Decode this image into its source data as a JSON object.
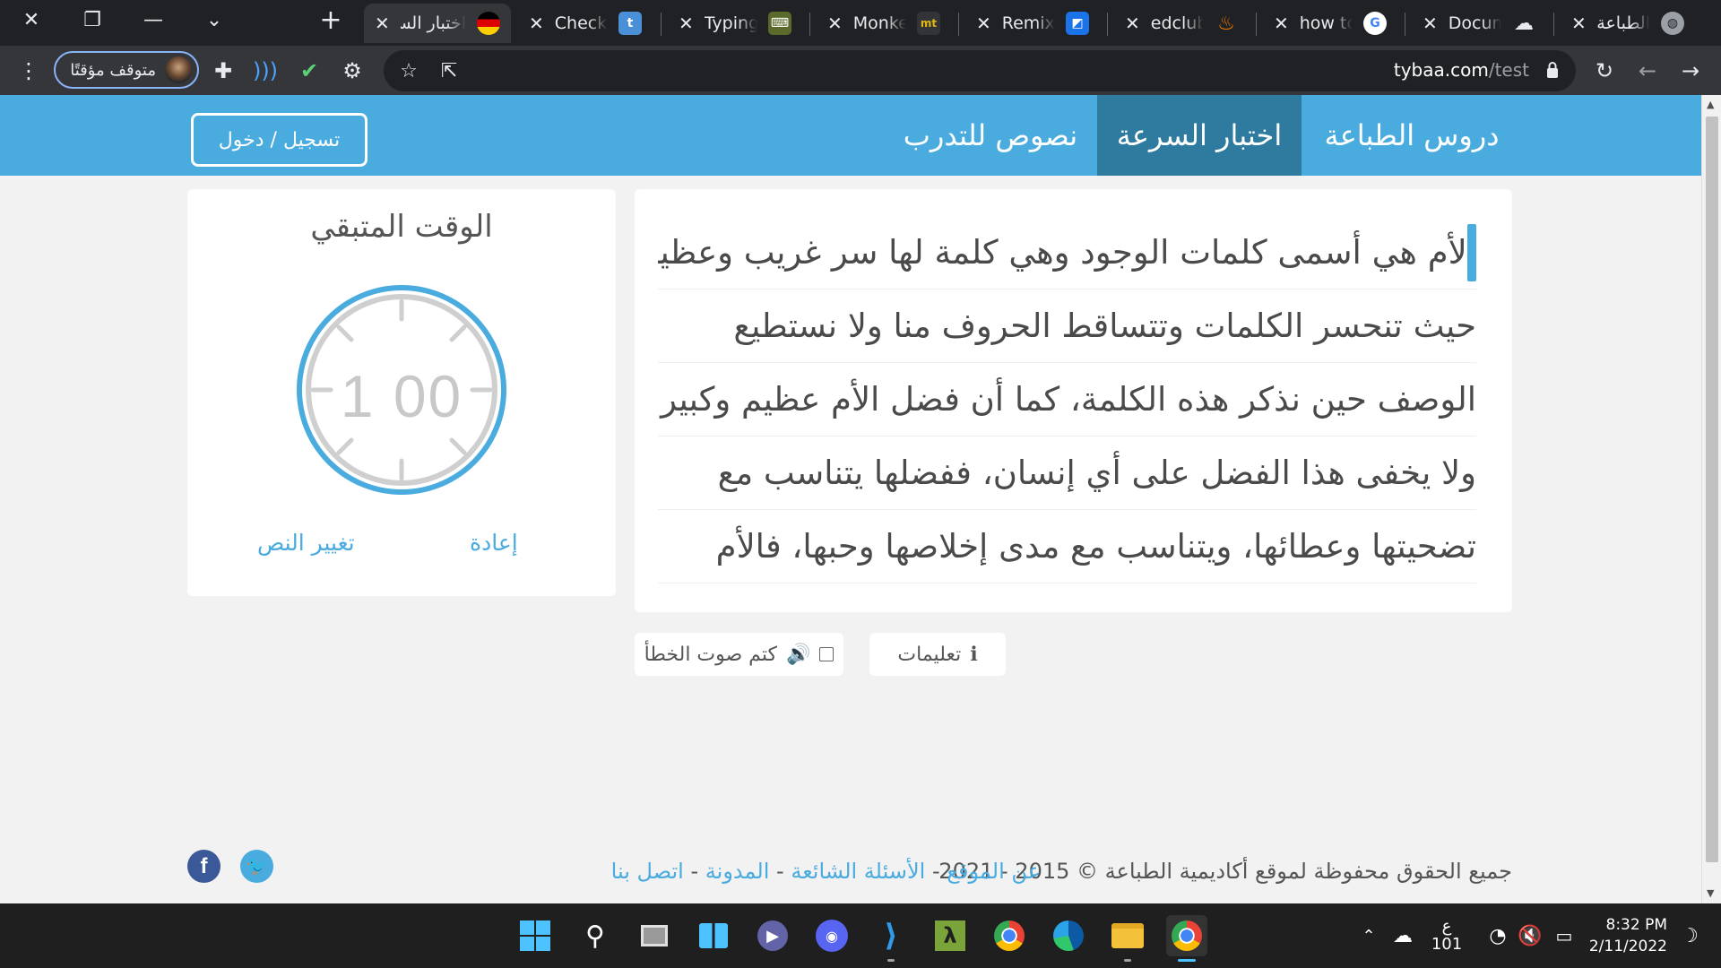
{
  "browser": {
    "window_controls": {
      "close": "✕",
      "restore": "❐",
      "minimize": "—",
      "tab_search": "⌄"
    },
    "new_tab_label": "+",
    "tabs": [
      {
        "title": "اختبار الس",
        "favicon": "german-flag-icon",
        "color": "#dd0000",
        "active": true
      },
      {
        "title": "Check yo",
        "favicon": "t-letter-icon",
        "favicon_text": "t",
        "color": "#4a90d9"
      },
      {
        "title": "Typing T",
        "favicon": "typing-keyboard-icon",
        "color": "#5a6a2a"
      },
      {
        "title": "Monkeyt",
        "favicon": "mt-icon",
        "favicon_text": "mt",
        "color": "#e2b714"
      },
      {
        "title": "Remix Ico",
        "favicon": "remix-icon",
        "color": "#1a73e8"
      },
      {
        "title": "edclub",
        "favicon": "edclub-flame-icon",
        "color": "#f57c00"
      },
      {
        "title": "how to m",
        "favicon": "google-icon",
        "favicon_text": "G",
        "color": "#ffffff"
      },
      {
        "title": "Documen",
        "favicon": "document-brain-icon",
        "color": "#e8eaed"
      },
      {
        "title": "الطباعة ب",
        "favicon": "globe-icon",
        "color": "#9aa0a6"
      }
    ],
    "profile_label": "متوقف مؤقتًا",
    "url_host": "tybaa.com",
    "url_path": "/test"
  },
  "site": {
    "nav": {
      "lessons": "دروس الطباعة",
      "speed_test": "اختبار السرعة",
      "practice_texts": "نصوص للتدرب",
      "login": "تسجيل / دخول"
    },
    "typing_text_lines": [
      "الأم هي أسمى كلمات الوجود وهي كلمة لها سر غريب وعظيم،",
      "حيث تنحسر الكلمات وتتساقط الحروف منا ولا نستطيع",
      "الوصف حين نذكر هذه الكلمة، كما أن فضل الأم عظيم وكبير",
      "ولا يخفى هذا الفضل على أي إنسان، ففضلها يتناسب مع",
      "تضحيتها وعطائها، ويتناسب مع مدى إخلاصها وحبها، فالأم"
    ],
    "timer": {
      "title": "الوقت المتبقي",
      "minutes": "1",
      "seconds": "00",
      "restart_label": "إعادة",
      "change_text_label": "تغيير النص",
      "ring_color": "#4aabdf"
    },
    "mute_label": "كتم صوت الخطأ",
    "instructions_label": "تعليمات",
    "footer": {
      "copyright": "جميع الحقوق محفوظة لموقع أكاديمية الطباعة © 2015 - 2021",
      "links": [
        "عن الموقع",
        "الأسئلة الشائعة",
        "المدونة",
        "اتصل بنا"
      ],
      "separator": "-"
    },
    "colors": {
      "primary": "#4aabdf",
      "nav_active": "#2f7a9f"
    }
  },
  "taskbar": {
    "weather_temp": "101",
    "weather_glyph": "ع",
    "time": "8:32 PM",
    "date": "2/11/2022"
  }
}
